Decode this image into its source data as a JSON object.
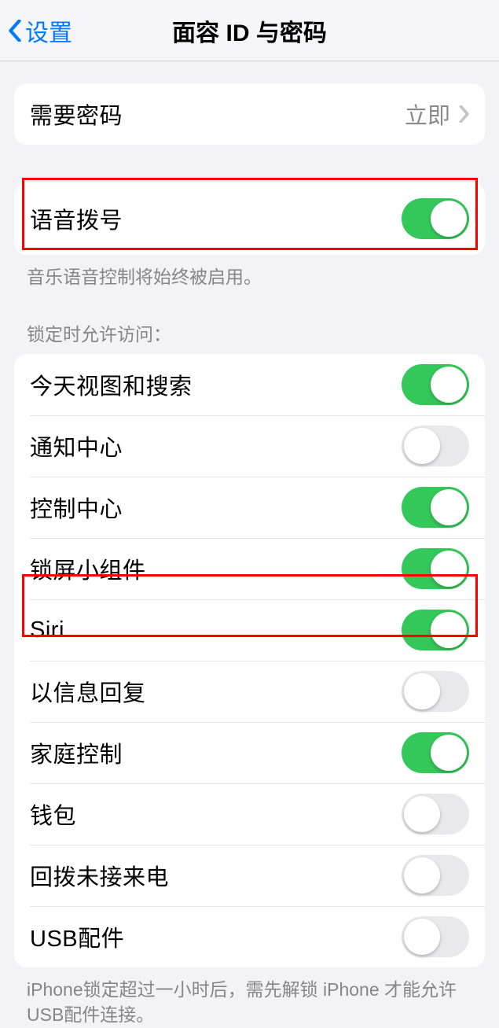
{
  "nav": {
    "back_label": "设置",
    "title": "面容 ID 与密码"
  },
  "passcode_group": {
    "require_passcode_label": "需要密码",
    "require_passcode_value": "立即"
  },
  "voice_group": {
    "voice_dial_label": "语音拨号",
    "voice_dial_on": true,
    "voice_footer": "音乐语音控制将始终被启用。"
  },
  "locked_access": {
    "header": "锁定时允许访问：",
    "items": [
      {
        "label": "今天视图和搜索",
        "on": true
      },
      {
        "label": "通知中心",
        "on": false
      },
      {
        "label": "控制中心",
        "on": true
      },
      {
        "label": "锁屏小组件",
        "on": true
      },
      {
        "label": "Siri",
        "on": true
      },
      {
        "label": "以信息回复",
        "on": false
      },
      {
        "label": "家庭控制",
        "on": true
      },
      {
        "label": "钱包",
        "on": false
      },
      {
        "label": "回拨未接来电",
        "on": false
      },
      {
        "label": "USB配件",
        "on": false
      }
    ],
    "footer": "iPhone锁定超过一小时后，需先解锁 iPhone 才能允许USB配件连接。"
  }
}
